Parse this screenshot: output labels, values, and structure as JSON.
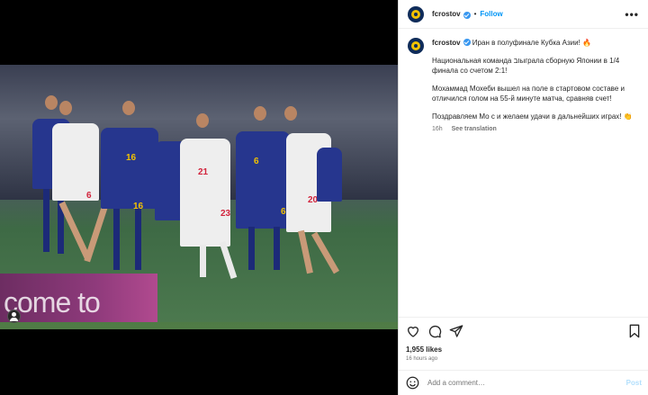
{
  "post": {
    "username": "fcrostov",
    "follow_label": "Follow",
    "dot": "•",
    "more_label": "•••"
  },
  "caption": {
    "username": "fcrostov",
    "line1": "Иран в полуфинале Кубка Азии! 🔥",
    "para1": "Национальная команда ובыграла сборную Японии в 1/4 финала со счетом 2:1!",
    "para2": "Мохаммад Мохеби вышел на поле в стартовом составе и отличился голом на 55-й минуте матча, сравняв счет!",
    "para3": "Поздравляем Мо с и желаем удачи в дальнейших играх! 👏",
    "time": "16h",
    "see_translation": "See translation"
  },
  "photo": {
    "billboard_text": "come to"
  },
  "stats": {
    "likes": "1,955 likes",
    "ago": "16 hours ago"
  },
  "comment": {
    "placeholder": "Add a comment…",
    "post_label": "Post"
  },
  "colors": {
    "accent": "#0095f6",
    "verified": "#3897f0",
    "iran_white": "#eeeeee",
    "japan_blue": "#26368e"
  },
  "icons": {
    "like": "heart-icon",
    "comment": "comment-icon",
    "share": "paper-plane-icon",
    "save": "bookmark-icon",
    "emoji": "smiley-icon",
    "tagged_users": "user-tag-icon"
  }
}
